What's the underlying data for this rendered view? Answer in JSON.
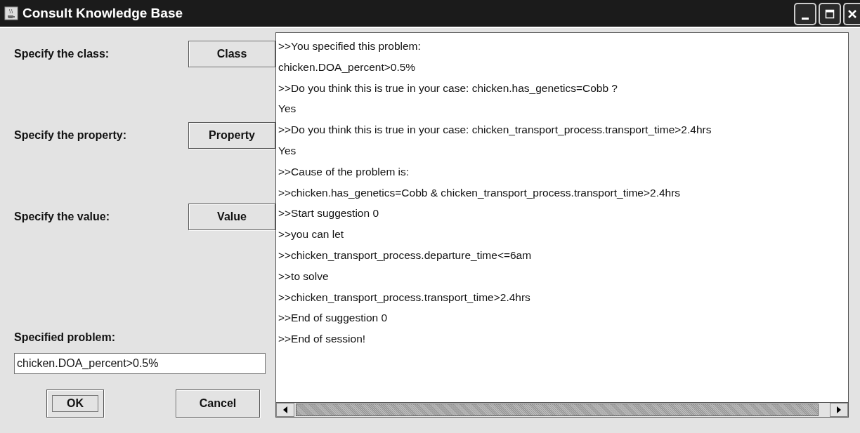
{
  "window": {
    "title": "Consult Knowledge Base"
  },
  "fields": [
    {
      "label": "Specify the class:",
      "button": "Class"
    },
    {
      "label": "Specify the property:",
      "button": "Property"
    },
    {
      "label": "Specify the value:",
      "button": "Value"
    }
  ],
  "problem": {
    "label": "Specified problem:",
    "value": "chicken.DOA_percent>0.5%"
  },
  "buttons": [
    {
      "label": "OK",
      "focused": true
    },
    {
      "label": "Cancel",
      "focused": false
    }
  ],
  "log": [
    ">>You specified this problem:",
    "chicken.DOA_percent>0.5%",
    ">>Do you think this is true in your case: chicken.has_genetics=Cobb  ?",
    "Yes",
    ">>Do you think this is true in your case:  chicken_transport_process.transport_time>2.4hrs",
    "Yes",
    ">>Cause of the problem is:",
    ">>chicken.has_genetics=Cobb & chicken_transport_process.transport_time>2.4hrs",
    ">>Start suggestion 0",
    ">>you can let",
    ">>chicken_transport_process.departure_time<=6am",
    ">>to solve",
    ">>chicken_transport_process.transport_time>2.4hrs",
    ">>End of suggestion 0",
    ">>End of session!"
  ]
}
